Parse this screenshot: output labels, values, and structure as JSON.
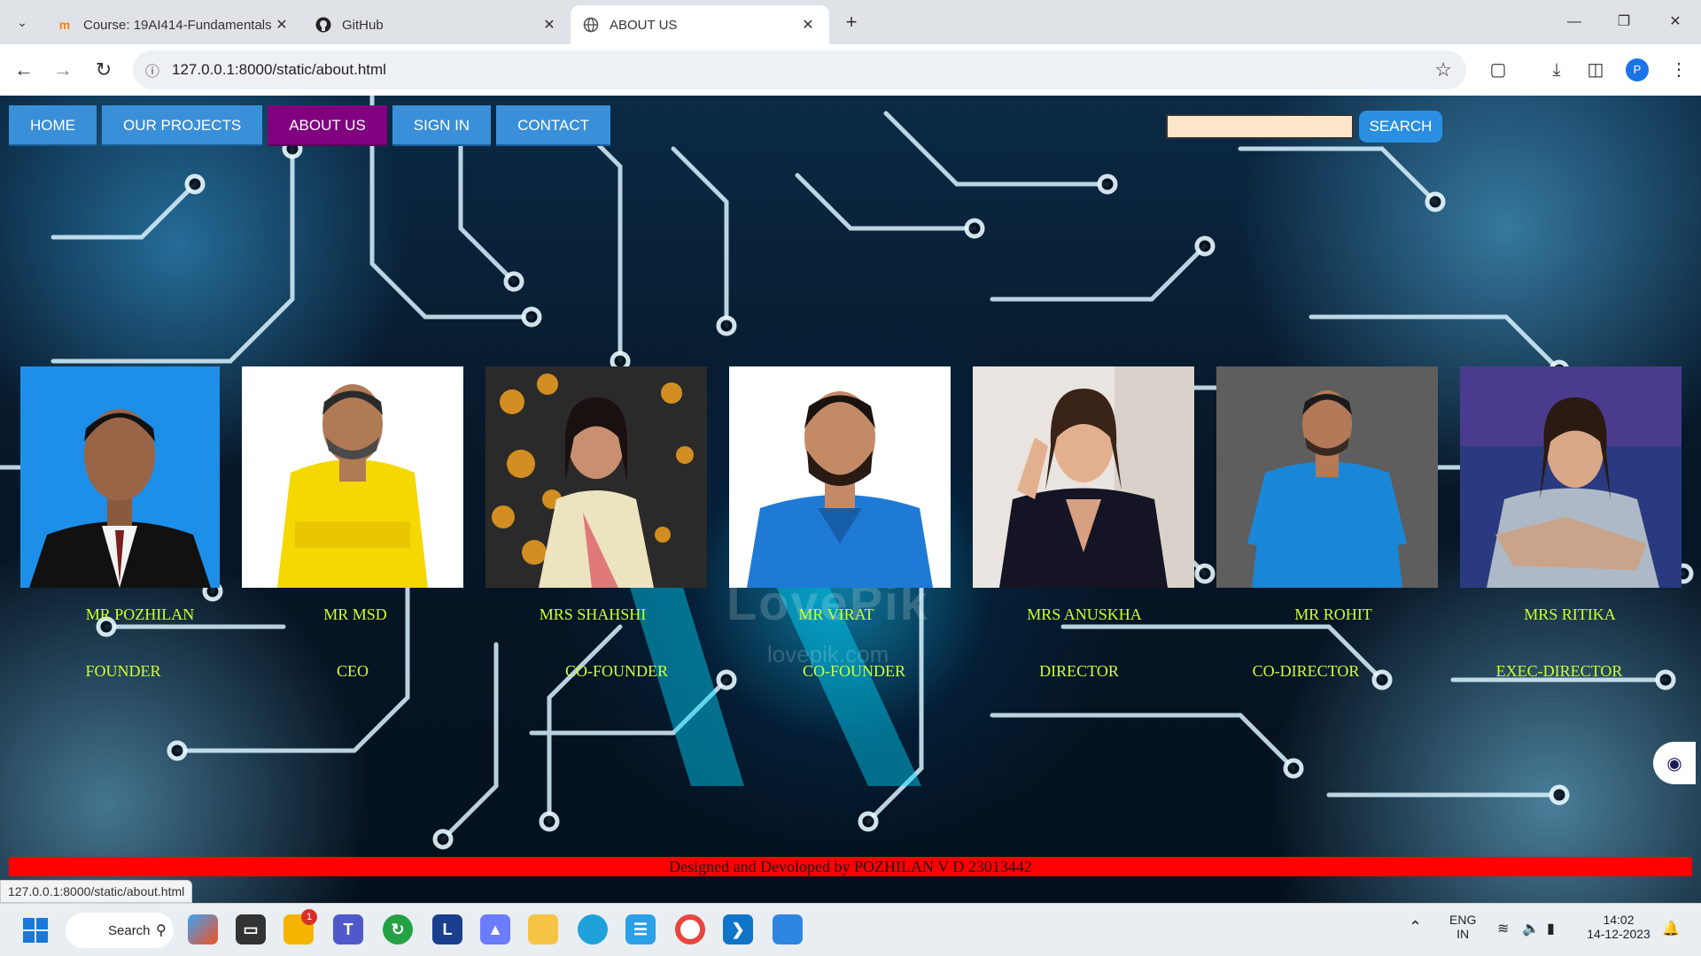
{
  "browser": {
    "tabs": [
      {
        "title": "Course: 19AI414-Fundamentals",
        "favicon": "moodle-icon",
        "active": false
      },
      {
        "title": "GitHub",
        "favicon": "github-icon",
        "active": false
      },
      {
        "title": "ABOUT US",
        "favicon": "globe-icon",
        "active": true
      }
    ],
    "url": "127.0.0.1:8000/static/about.html",
    "profile_initial": "P",
    "status_url": "127.0.0.1:8000/static/about.html"
  },
  "site": {
    "nav": [
      "HOME",
      "OUR PROJECTS",
      "ABOUT US",
      "SIGN IN",
      "CONTACT"
    ],
    "active_nav": "ABOUT US",
    "search_button": "SEARCH",
    "search_value": "",
    "team": [
      {
        "name": "MR POZHILAN",
        "role": "FOUNDER"
      },
      {
        "name": "MR MSD",
        "role": "CEO"
      },
      {
        "name": "MRS SHAHSHI",
        "role": "CO-FOUNDER"
      },
      {
        "name": "MR VIRAT",
        "role": "CO-FOUNDER"
      },
      {
        "name": "MRS ANUSKHA",
        "role": "DIRECTOR"
      },
      {
        "name": "MR ROHIT",
        "role": "CO-DIRECTOR"
      },
      {
        "name": "MRS RITIKA",
        "role": "EXEC-DIRECTOR"
      }
    ],
    "watermark": "LovePik",
    "watermark_url": "lovepik.com",
    "footer": "Designed and Devoloped by POZHILAN V D 23013442",
    "colors": {
      "nav": "#3a8fd9",
      "nav_active": "#800080",
      "text_accent": "#ccff33",
      "footer": "#ff0000"
    }
  },
  "taskbar": {
    "search_label": "Search",
    "notification_badge": "1",
    "lang_top": "ENG",
    "lang_bottom": "IN",
    "time": "14:02",
    "date": "14-12-2023"
  }
}
